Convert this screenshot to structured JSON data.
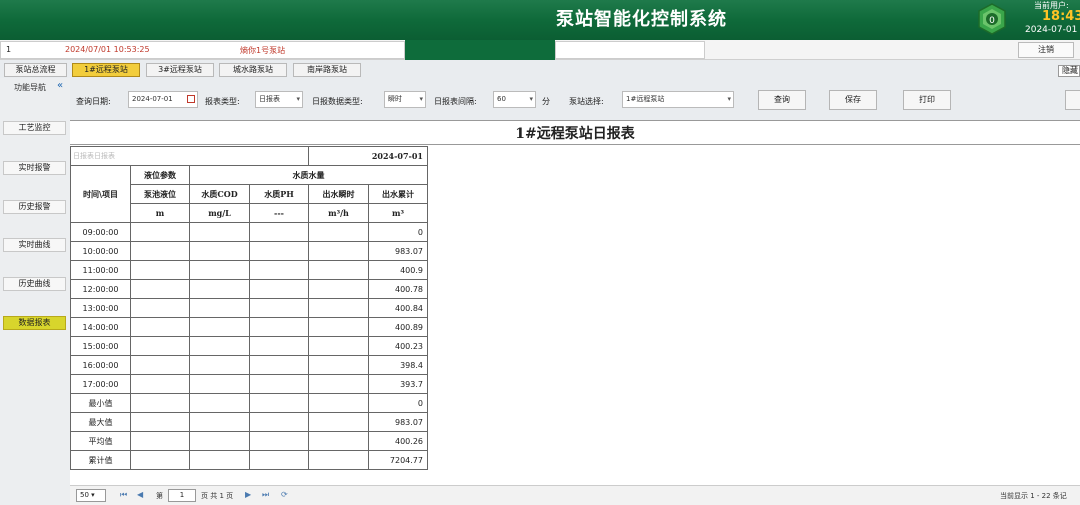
{
  "header": {
    "title": "泵站智能化控制系统",
    "user_label": "当前用户:",
    "clock": "18:43",
    "date": "2024-07-01"
  },
  "statusbar": {
    "index": "1",
    "time": "2024/07/01 10:53:25",
    "alarm": "熵你1号泵站",
    "logout_label": "注销"
  },
  "tabs": [
    {
      "label": "泵站总流程"
    },
    {
      "label": "1#远程泵站"
    },
    {
      "label": "3#远程泵站"
    },
    {
      "label": "城水路泵站"
    },
    {
      "label": "南岸路泵站"
    }
  ],
  "hide_label": "隐藏",
  "sidebar": {
    "title": "功能导航",
    "collapse_icon": "«",
    "items": [
      {
        "label": "工艺监控"
      },
      {
        "label": "实时报警"
      },
      {
        "label": "历史报警"
      },
      {
        "label": "实时曲线"
      },
      {
        "label": "历史曲线"
      },
      {
        "label": "数据报表"
      }
    ]
  },
  "toolbar": {
    "query_date_label": "查询日期:",
    "query_date_value": "2024-07-01",
    "report_type_label": "报表类型:",
    "report_type_value": "日报表",
    "data_type_label": "日报数据类型:",
    "data_type_value": "瞬时",
    "interval_label": "日报表间隔:",
    "interval_value": "60",
    "interval_unit": "分",
    "station_label": "泵站选择:",
    "station_value": "1#远程泵站",
    "query_btn": "查询",
    "save_btn": "保存",
    "print_btn": "打印"
  },
  "report": {
    "title": "1#远程泵站日报表",
    "blur_text": "日报表日报表",
    "date": "2024-07-01",
    "header_group1": "液位参数",
    "header_group2": "水质水量",
    "row_header": "时间\\项目",
    "columns": [
      "泵池液位",
      "水质COD",
      "水质PH",
      "出水瞬时",
      "出水累计"
    ],
    "units": [
      "m",
      "mg/L",
      "---",
      "m³/h",
      "m³"
    ],
    "rows": [
      {
        "time": "09:00:00",
        "total": "0"
      },
      {
        "time": "10:00:00",
        "total": "983.07"
      },
      {
        "time": "11:00:00",
        "total": "400.9"
      },
      {
        "time": "12:00:00",
        "total": "400.78"
      },
      {
        "time": "13:00:00",
        "total": "400.84"
      },
      {
        "time": "14:00:00",
        "total": "400.89"
      },
      {
        "time": "15:00:00",
        "total": "400.23"
      },
      {
        "time": "16:00:00",
        "total": "398.4"
      },
      {
        "time": "17:00:00",
        "total": "393.7"
      },
      {
        "time": "最小值",
        "total": "0"
      },
      {
        "time": "最大值",
        "total": "983.07"
      },
      {
        "time": "平均值",
        "total": "400.26"
      },
      {
        "time": "累计值",
        "total": "7204.77"
      }
    ]
  },
  "footer": {
    "page_size": "50",
    "page_prefix": "第",
    "page_value": "1",
    "page_suffix": "页 共 1 页",
    "summary": "当前显示 1 - 22 条记"
  },
  "colors": {
    "header_green": "#0f6a3a",
    "active_tab": "#f2cd3c",
    "active_sidebar": "#d8d52c",
    "clock": "#ffc425"
  }
}
